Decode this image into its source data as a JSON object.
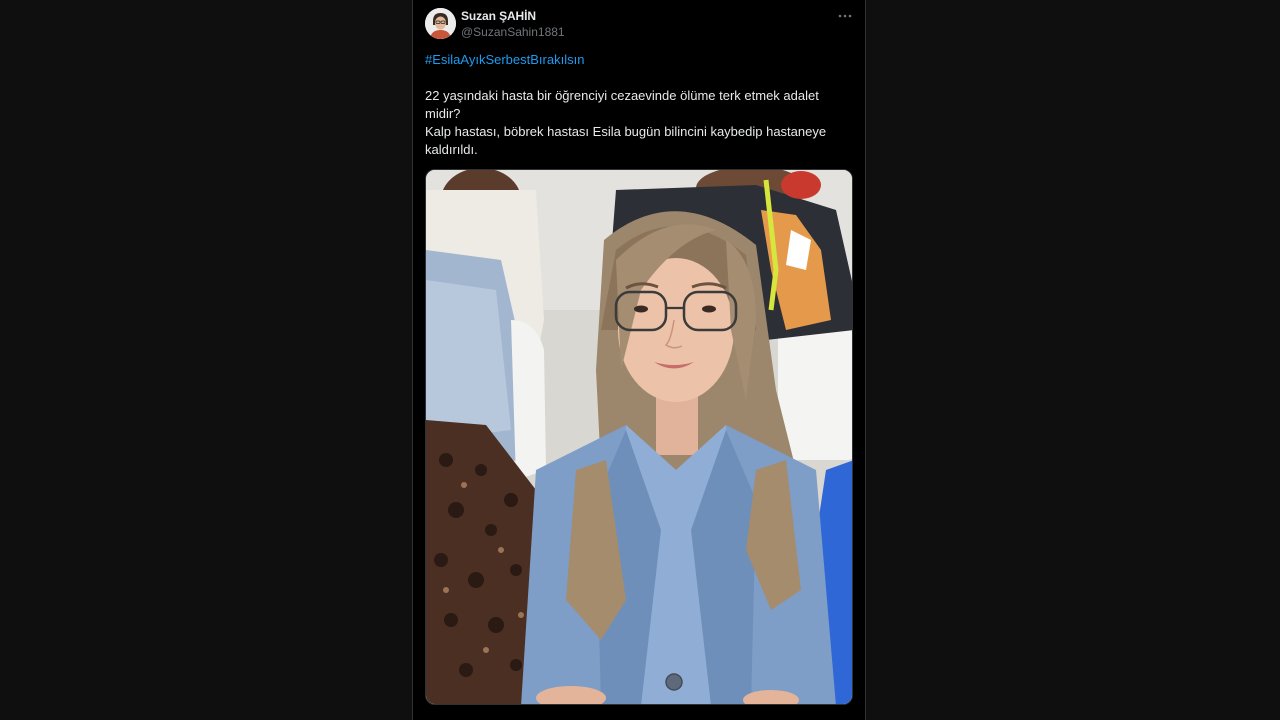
{
  "author": {
    "display_name": "Suzan ŞAHİN",
    "handle": "@SuzanSahin1881",
    "avatar_icon": "user-avatar"
  },
  "menu": {
    "more_icon": "more-horizontal-icon"
  },
  "tweet": {
    "hashtag": "#EsilaAyıkSerbestBırakılsın",
    "line1": "22 yaşındaki hasta bir öğrenciyi cezaevinde ölüme terk etmek adalet midir?",
    "line2": "Kalp hastası, böbrek hastası Esila bugün bilincini kaybedip hastaneye kaldırıldı."
  },
  "media": {
    "type": "photo"
  },
  "colors": {
    "background": "#000000",
    "page": "#0f0f0f",
    "text": "#e7e9ea",
    "secondary": "#71767b",
    "link": "#1d9bf0"
  }
}
